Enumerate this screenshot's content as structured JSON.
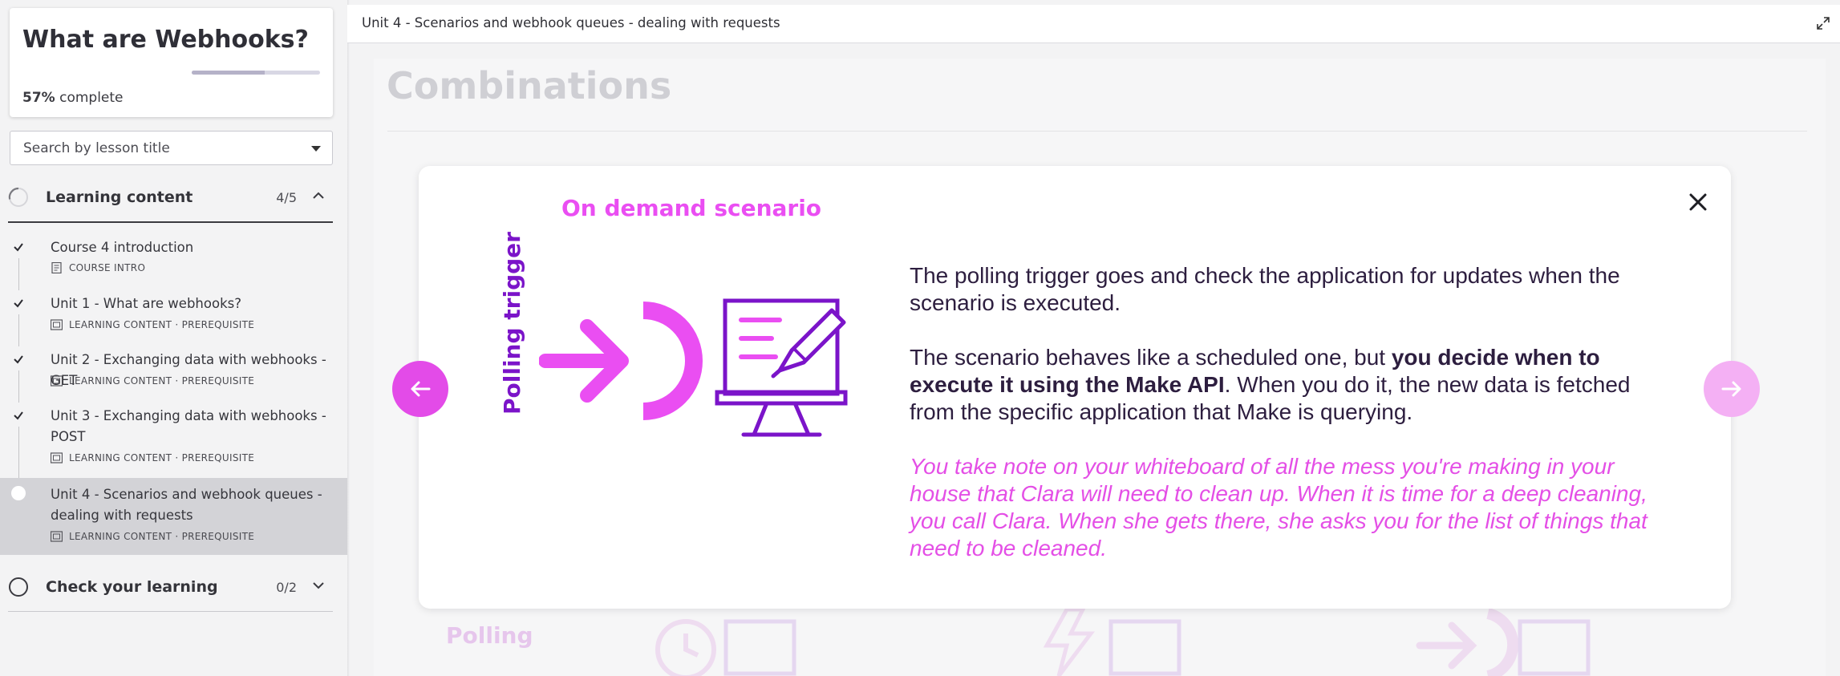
{
  "course": {
    "title": "What are Webhooks?",
    "progress_percent": 57,
    "progress_value": "57%",
    "progress_suffix": "complete"
  },
  "search": {
    "placeholder": "Search by lesson title"
  },
  "sections": [
    {
      "title": "Learning content",
      "count": "4/5",
      "expanded": true
    },
    {
      "title": "Check your learning",
      "count": "0/2",
      "expanded": false
    }
  ],
  "lessons": [
    {
      "title": "Course 4 introduction",
      "meta": "COURSE INTRO",
      "completed": true
    },
    {
      "title": "Unit 1 - What are webhooks?",
      "meta": "LEARNING CONTENT · PREREQUISITE",
      "completed": true
    },
    {
      "title": "Unit 2 - Exchanging data with webhooks - GET",
      "meta": "LEARNING CONTENT · PREREQUISITE",
      "completed": true
    },
    {
      "title": "Unit 3 - Exchanging data with webhooks - POST",
      "meta": "LEARNING CONTENT · PREREQUISITE",
      "completed": true
    },
    {
      "title": "Unit 4 - Scenarios and webhook queues - dealing with requests",
      "meta": "LEARNING CONTENT · PREREQUISITE",
      "completed": false,
      "active": true
    }
  ],
  "topbar": {
    "title": "Unit 4 - Scenarios and webhook queues - dealing with requests"
  },
  "page": {
    "heading": "Combinations",
    "bg_label": "Polling"
  },
  "modal": {
    "heading": "On demand scenario",
    "vertical_label": "Polling trigger",
    "para1": "The polling trigger goes and check the application for updates when the scenario is executed.",
    "para2_start": "The scenario behaves like a scheduled one, but ",
    "para2_bold": "you decide when to execute it using the Make API",
    "para2_end": ". When you do it, the new data is fetched from the specific application that Make is querying.",
    "para3": "You take note on your whiteboard of all the mess you're making in your house that Clara will need to clean up. When it is time for a deep cleaning, you call Clara. When she gets there, she asks you for the list of things that need to be cleaned."
  },
  "colors": {
    "accent_pink": "#ea4ef2",
    "accent_purple": "#7b14c9",
    "nav_prev": "#e34be8",
    "nav_next": "#f4b0f4"
  },
  "icons": {
    "close": "close-icon",
    "expand": "expand-icon",
    "prev": "arrow-left-icon",
    "next": "arrow-right-icon",
    "check": "check-icon",
    "lesson_type": "slides-icon"
  }
}
